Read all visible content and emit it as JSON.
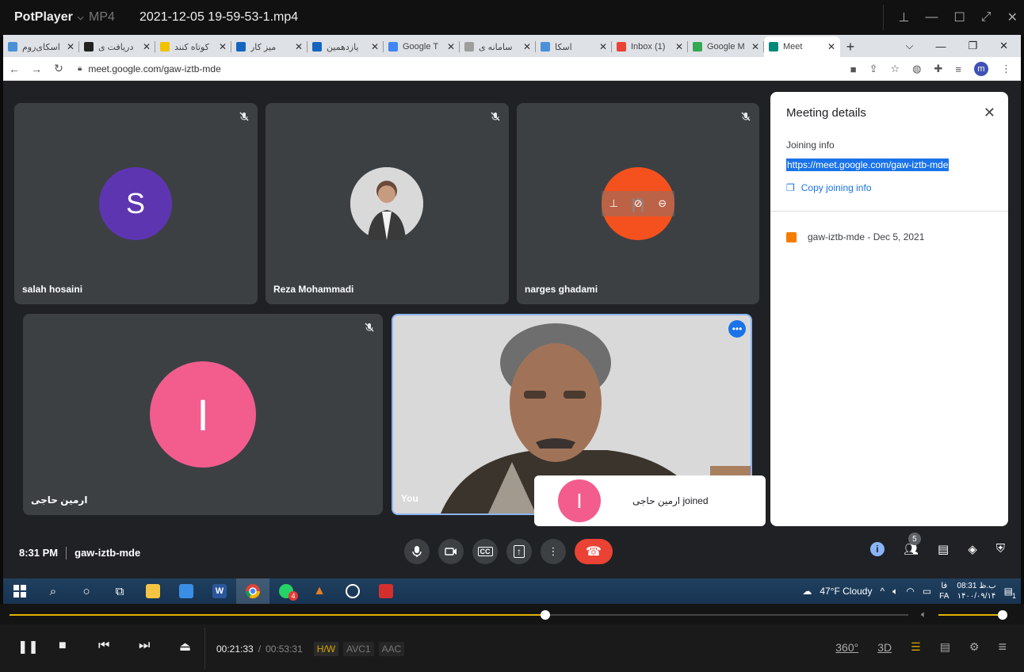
{
  "player": {
    "brand": "PotPlayer",
    "format": "MP4",
    "filename": "2021-12-05 19-59-53-1.mp4",
    "current_time": "00:21:33",
    "separator": "/",
    "duration": "00:53:31",
    "tag_hw": "H/W",
    "tag_video": "AVC1",
    "tag_audio": "AAC",
    "btn_360": "360°",
    "btn_3d": "3D",
    "seek_progress": 0.596,
    "volume_level": 1.0
  },
  "browser": {
    "tabs": [
      {
        "label": "اسکای‌روم",
        "icon_color": "#4a90d9"
      },
      {
        "label": "دریافت ی",
        "icon_color": "#222222"
      },
      {
        "label": "کوتاه کنند",
        "icon_color": "#f2c200"
      },
      {
        "label": "میز کار",
        "icon_color": "#1565c0"
      },
      {
        "label": "یازدهمین",
        "icon_color": "#1565c0"
      },
      {
        "label": "Google T",
        "icon_color": "#4285f4"
      },
      {
        "label": "سامانه ی",
        "icon_color": "#9e9e9e"
      },
      {
        "label": "اسکا",
        "icon_color": "#4a90d9"
      },
      {
        "label": "Inbox (1)",
        "icon_color": "#ea4335"
      },
      {
        "label": "Google M",
        "icon_color": "#34a853"
      },
      {
        "label": "Meet",
        "icon_color": "#00897b",
        "active": true
      }
    ],
    "url": "meet.google.com/gaw-iztb-mde",
    "profile_initial": "m"
  },
  "meet": {
    "participants": [
      {
        "name": "salah hosaini",
        "initial": "S",
        "color": "#5e35b1"
      },
      {
        "name": "Reza Mohammadi",
        "initial": "",
        "color": "#8d8d8d"
      },
      {
        "name": "narges ghadami",
        "initial": "n",
        "color": "#f4511e"
      },
      {
        "name": "ارمین حاجی",
        "initial": "I",
        "color": "#f25d8e"
      },
      {
        "name": "You",
        "initial": "",
        "color": "#d8d8d8"
      }
    ],
    "details": {
      "title": "Meeting details",
      "joining_label": "Joining info",
      "joining_link": "https://meet.google.com/gaw-iztb-mde",
      "copy_label": "Copy joining info",
      "calendar_entry": "gaw-iztb-mde - Dec 5, 2021"
    },
    "toast": {
      "initial": "I",
      "text": "ارمین حاجی joined"
    },
    "bottom": {
      "time": "8:31 PM",
      "code": "gaw-iztb-mde",
      "people_count": "5"
    }
  },
  "taskbar": {
    "weather": "47°F  Cloudy",
    "lang_top": "فا",
    "lang_bottom": "FA",
    "clock_time": "08:31 ب.ظ",
    "clock_date": "۱۴۰۰/۰۹/۱۴",
    "whatsapp_badge": "4",
    "notif_count": "1"
  }
}
